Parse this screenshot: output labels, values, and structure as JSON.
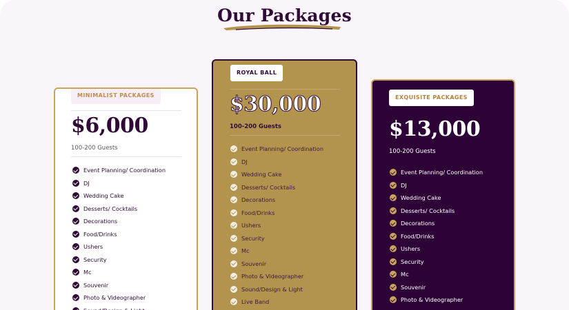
{
  "heading": "Our Packages",
  "colors": {
    "page_bg": "#faf4fb",
    "primary_purple": "#2f0a37",
    "gold": "#b3944f",
    "gold_border": "#c9a45b"
  },
  "icons": {
    "check": "check-circle-icon"
  },
  "packages": [
    {
      "name": "MINIMALIST PACKAGES",
      "price": "$6,000",
      "guests": "100-200 Guests",
      "features": [
        "Event Planning/ Coordination",
        "DJ",
        "Wedding Cake",
        "Desserts/ Cocktails",
        "Decorations",
        "Food/Drinks",
        "Ushers",
        "Security",
        "Mc",
        "Souvenir",
        "Photo & Videographer",
        "Sound/Design & Light"
      ]
    },
    {
      "name": "ROYAL BALL",
      "price": "$30,000",
      "guests": "100-200 Guests",
      "features": [
        "Event Planning/ Coordination",
        "DJ",
        "Wedding Cake",
        "Desserts/ Cocktails",
        "Decorations",
        "Food/Drinks",
        "Ushers",
        "Security",
        "Mc",
        "Souvenir",
        "Photo & Videographer",
        "Sound/Design & Light",
        "Live Band"
      ]
    },
    {
      "name": "EXQUISITE PACKAGES",
      "price": "$13,000",
      "guests": "100-200 Guests",
      "features": [
        "Event Planning/ Coordination",
        "DJ",
        "Wedding Cake",
        "Desserts/ Cocktails",
        "Decorations",
        "Food/Drinks",
        "Ushers",
        "Security",
        "Mc",
        "Souvenir",
        "Photo & Videographer"
      ]
    }
  ]
}
